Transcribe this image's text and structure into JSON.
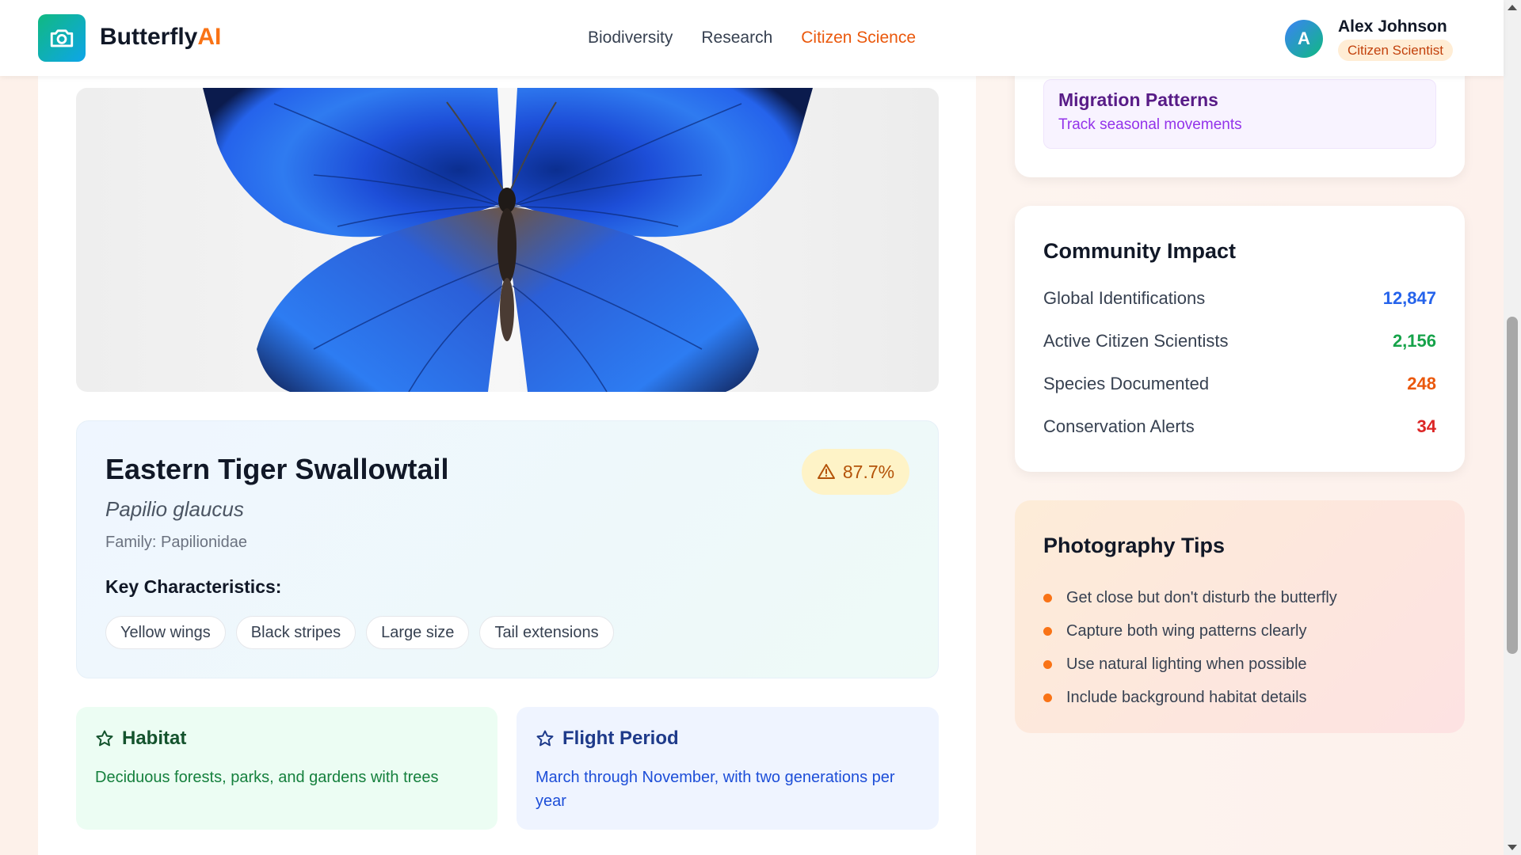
{
  "header": {
    "brand_main": "Butterfly",
    "brand_accent": "AI",
    "nav": [
      {
        "label": "Biodiversity",
        "active": false
      },
      {
        "label": "Research",
        "active": false
      },
      {
        "label": "Citizen Science",
        "active": true
      }
    ],
    "user": {
      "initial": "A",
      "name": "Alex Johnson",
      "role": "Citizen Scientist"
    },
    "logo_icon": "camera-icon"
  },
  "hero": {
    "icon": "blue-morpho-butterfly-photo"
  },
  "species": {
    "name": "Eastern Tiger Swallowtail",
    "scientific": "Papilio glaucus",
    "family": "Family: Papilionidae",
    "confidence": "87.7%",
    "confidence_icon": "warning-triangle-icon",
    "key_label": "Key Characteristics:",
    "characteristics": [
      "Yellow wings",
      "Black stripes",
      "Large size",
      "Tail extensions"
    ]
  },
  "info": {
    "habitat": {
      "title": "Habitat",
      "text": "Deciduous forests, parks, and gardens with trees",
      "icon": "star-icon"
    },
    "flight": {
      "title": "Flight Period",
      "text": "March through November, with two generations per year",
      "icon": "star-icon"
    }
  },
  "sidebar": {
    "migration": {
      "title": "Migration Patterns",
      "subtitle": "Track seasonal movements"
    },
    "impact": {
      "title": "Community Impact",
      "stats": [
        {
          "label": "Global Identifications",
          "value": "12,847",
          "color": "#2563eb"
        },
        {
          "label": "Active Citizen Scientists",
          "value": "2,156",
          "color": "#16a34a"
        },
        {
          "label": "Species Documented",
          "value": "248",
          "color": "#ea580c"
        },
        {
          "label": "Conservation Alerts",
          "value": "34",
          "color": "#dc2626"
        }
      ]
    },
    "tips": {
      "title": "Photography Tips",
      "items": [
        "Get close but don't disturb the butterfly",
        "Capture both wing patterns clearly",
        "Use natural lighting when possible",
        "Include background habitat details"
      ]
    }
  },
  "colors": {
    "accent": "#f97316",
    "brand_gradient_start": "#10b981",
    "brand_gradient_end": "#0ea5e9"
  }
}
